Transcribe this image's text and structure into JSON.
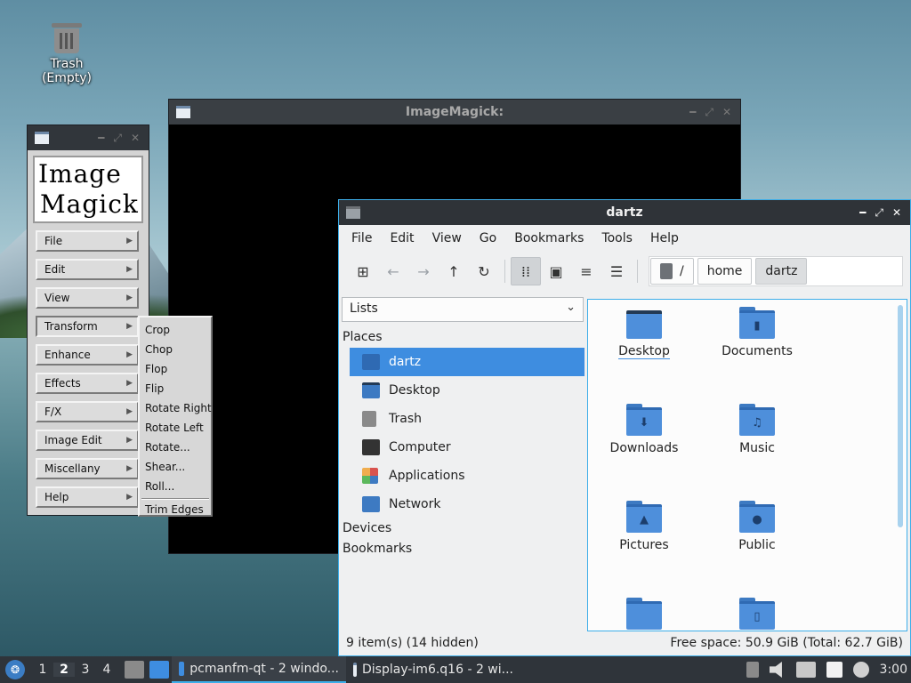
{
  "desktop": {
    "trash_label": "Trash (Empty)"
  },
  "im_display": {
    "title": "ImageMagick:"
  },
  "im_command": {
    "logo_line1": "Image",
    "logo_line2": "Magick",
    "buttons": [
      "File",
      "Edit",
      "View",
      "Transform",
      "Enhance",
      "Effects",
      "F/X",
      "Image Edit",
      "Miscellany",
      "Help"
    ]
  },
  "transform_menu": {
    "items": [
      "Crop",
      "Chop",
      "Flop",
      "Flip",
      "Rotate Right",
      "Rotate Left",
      "Rotate...",
      "Shear...",
      "Roll..."
    ],
    "last_item": "Trim Edges"
  },
  "file_manager": {
    "title": "dartz",
    "menu": [
      "File",
      "Edit",
      "View",
      "Go",
      "Bookmarks",
      "Tools",
      "Help"
    ],
    "path": {
      "root": "/",
      "segments": [
        "home",
        "dartz"
      ]
    },
    "side_combo": "Lists",
    "places_header": "Places",
    "places": [
      {
        "label": "dartz",
        "icon": "home-icon",
        "color": "#3e8de0"
      },
      {
        "label": "Desktop",
        "icon": "desktop-icon",
        "color": "#3d7ac2"
      },
      {
        "label": "Trash",
        "icon": "trash-icon",
        "color": "#8a8a8a"
      },
      {
        "label": "Computer",
        "icon": "computer-icon",
        "color": "#333333"
      },
      {
        "label": "Applications",
        "icon": "applications-icon",
        "color": "#d9534f"
      },
      {
        "label": "Network",
        "icon": "network-icon",
        "color": "#3d7ac2"
      }
    ],
    "devices_header": "Devices",
    "bookmarks_header": "Bookmarks",
    "items": [
      {
        "label": "Desktop",
        "icon": "desktop-folder-icon"
      },
      {
        "label": "Documents",
        "icon": "documents-folder-icon"
      },
      {
        "label": "Downloads",
        "icon": "downloads-folder-icon"
      },
      {
        "label": "Music",
        "icon": "music-folder-icon"
      },
      {
        "label": "Pictures",
        "icon": "pictures-folder-icon"
      },
      {
        "label": "Public",
        "icon": "public-folder-icon"
      }
    ],
    "status_left": "9 item(s) (14 hidden)",
    "status_right": "Free space: 50.9 GiB (Total: 62.7 GiB)"
  },
  "taskbar": {
    "workspaces": [
      "1",
      "2",
      "3",
      "4"
    ],
    "current_workspace": "2",
    "tasks": [
      {
        "label": "pcmanfm-qt - 2 windo..."
      },
      {
        "label": "Display-im6.q16 - 2 wi..."
      }
    ],
    "clock": "3:00"
  },
  "colors": {
    "accent": "#3daee9",
    "selection": "#3e8de0",
    "titlebar": "#31363b"
  }
}
